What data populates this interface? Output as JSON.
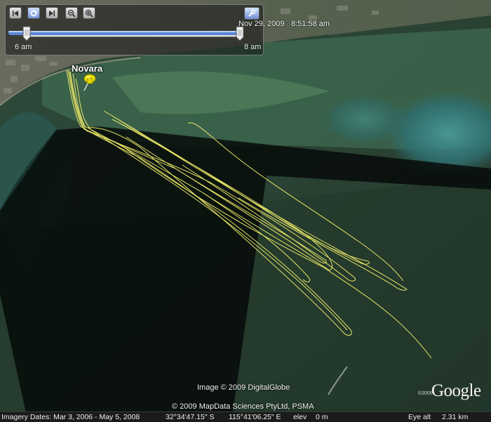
{
  "time_slider": {
    "date": "Nov 29, 2009",
    "time": "8:51:58 am",
    "start_label": "6 am",
    "end_label": "8 am"
  },
  "map": {
    "place_label": "Novara",
    "track_color": "#f0ec6a",
    "pin_color": "#f2e300"
  },
  "credits": {
    "image": "Image © 2009 DigitalGlobe",
    "map_data": "© 2009 MapData Sciences PtyLtd, PSMA",
    "logo": "Google",
    "logo_year": "©2009"
  },
  "status_bar": {
    "imagery_dates": "Imagery Dates: Mar 3, 2006 - May 5, 2008",
    "latitude": "32°34'47.15\" S",
    "longitude": "115°41'06.25\" E",
    "elev_label": "elev",
    "elev_value": "0 m",
    "eye_alt_label": "Eye alt",
    "eye_alt_value": "2.31 km"
  }
}
